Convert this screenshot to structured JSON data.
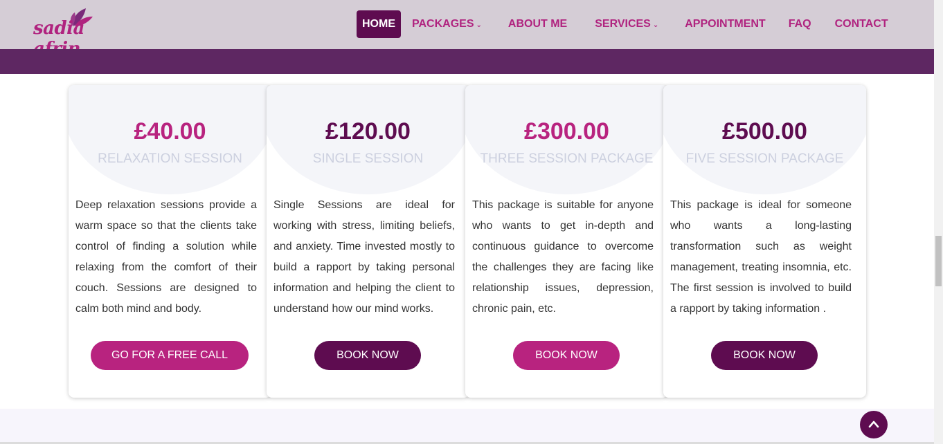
{
  "colors": {
    "accent_magenta": "#b8237f",
    "accent_dark": "#5e0c50",
    "header_bg": "#d5cdd6",
    "band": "#5e2762"
  },
  "header": {
    "logo_text": "sadia afrin",
    "nav": [
      {
        "label": "HOME",
        "active": true
      },
      {
        "label": "PACKAGES",
        "dropdown": true
      },
      {
        "label": "ABOUT ME"
      },
      {
        "label": "SERVICES",
        "dropdown": true
      },
      {
        "label": "APPOINTMENT"
      },
      {
        "label": "FAQ"
      },
      {
        "label": "CONTACT"
      }
    ]
  },
  "cards": [
    {
      "price": "£40.00",
      "title": "RELAXATION SESSION",
      "description": "Deep relaxation sessions provide a warm space so that the clients take control of finding a solution while relaxing from the comfort of their couch. Sessions are designed to calm both mind and body.",
      "button": "GO FOR A FREE CALL"
    },
    {
      "price": "£120.00",
      "title": "SINGLE SESSION",
      "description": "Single Sessions are ideal for working with stress, limiting beliefs, and anxiety. Time invested mostly to build a rapport by taking personal information and helping the client to understand how our mind works.",
      "button": "BOOK NOW"
    },
    {
      "price": "£300.00",
      "title": "THREE SESSION PACKAGE",
      "description": "This package is suitable for anyone who wants to get in-depth and continuous guidance to overcome the challenges they are facing like relationship issues, depression, chronic pain, etc.",
      "button": "BOOK NOW"
    },
    {
      "price": "£500.00",
      "title": "FIVE SESSION PACKAGE",
      "description": "This package is ideal for someone who wants a long-lasting transformation such as weight management, treating insomnia, etc. The first session is involved to build a rapport by taking information .",
      "button": "BOOK NOW"
    }
  ],
  "icons": {
    "logo_leaf": "leaf-icon",
    "dropdown": "chevron-down-icon",
    "back_to_top": "chevron-up-icon"
  }
}
